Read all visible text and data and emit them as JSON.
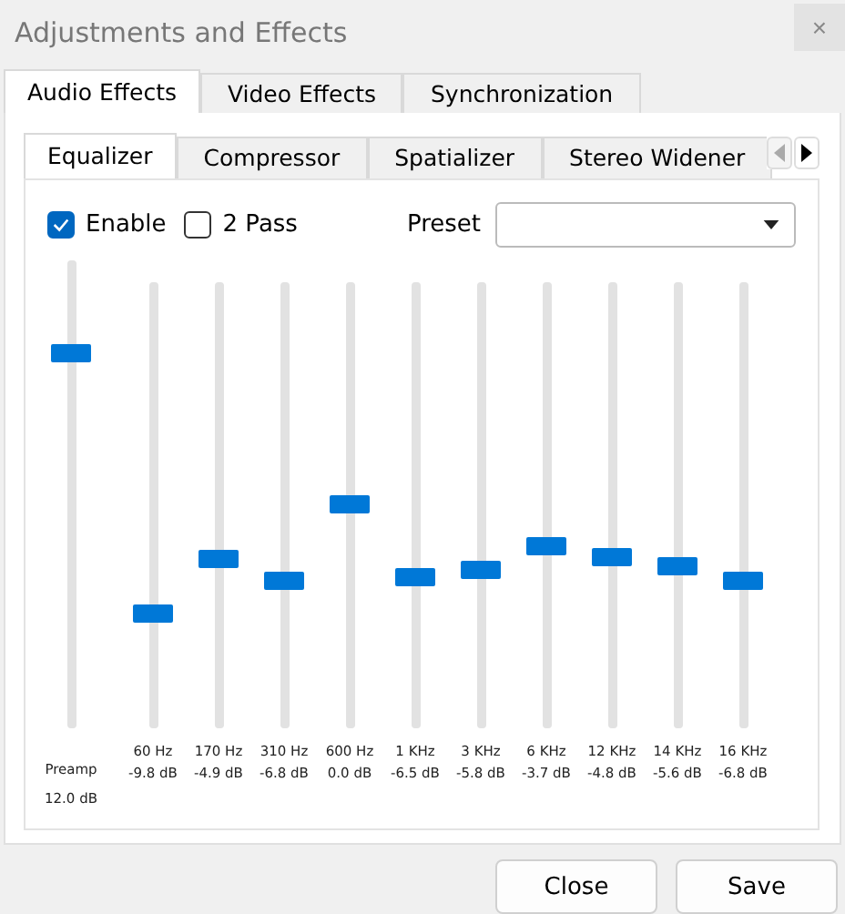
{
  "window": {
    "title": "Adjustments and Effects",
    "close": "×"
  },
  "tabs": [
    {
      "label": "Audio Effects",
      "selected": true
    },
    {
      "label": "Video Effects",
      "selected": false
    },
    {
      "label": "Synchronization",
      "selected": false
    }
  ],
  "subtabs": [
    {
      "label": "Equalizer",
      "selected": true
    },
    {
      "label": "Compressor",
      "selected": false
    },
    {
      "label": "Spatializer",
      "selected": false
    },
    {
      "label": "Stereo Widener",
      "selected": false
    }
  ],
  "options": [
    {
      "label": "Enable",
      "checked": true
    },
    {
      "label": "2 Pass",
      "checked": false
    }
  ],
  "preset": {
    "label": "Preset"
  },
  "preamp": {
    "name": "Preamp",
    "reading": "12.0 dB",
    "level": 0.8
  },
  "bands": [
    {
      "name": "60 Hz",
      "reading": "-9.8 dB",
      "level": 0.255
    },
    {
      "name": "170 Hz",
      "reading": "-4.9 dB",
      "level": 0.3775
    },
    {
      "name": "310 Hz",
      "reading": "-6.8 dB",
      "level": 0.33
    },
    {
      "name": "600 Hz",
      "reading": "0.0 dB",
      "level": 0.5
    },
    {
      "name": "1 KHz",
      "reading": "-6.5 dB",
      "level": 0.3375
    },
    {
      "name": "3 KHz",
      "reading": "-5.8 dB",
      "level": 0.355
    },
    {
      "name": "6 KHz",
      "reading": "-3.7 dB",
      "level": 0.4075
    },
    {
      "name": "12 KHz",
      "reading": "-4.8 dB",
      "level": 0.38
    },
    {
      "name": "14 KHz",
      "reading": "-5.6 dB",
      "level": 0.36
    },
    {
      "name": "16 KHz",
      "reading": "-6.8 dB",
      "level": 0.33
    }
  ],
  "buttons": [
    "Close",
    "Save"
  ]
}
